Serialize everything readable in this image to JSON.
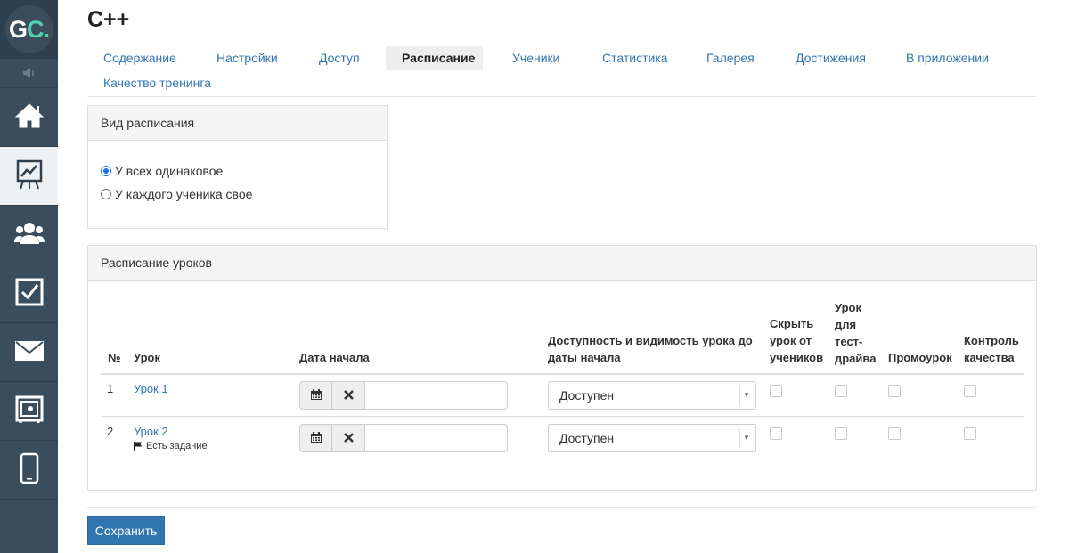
{
  "sidebar": {
    "logo_text": "GC",
    "logo_dot": ".",
    "items": [
      {
        "icon": "home-icon"
      },
      {
        "icon": "chart-board-icon",
        "active": true
      },
      {
        "icon": "users-icon"
      },
      {
        "icon": "checkbox-icon"
      },
      {
        "icon": "mail-icon"
      },
      {
        "icon": "safe-icon"
      },
      {
        "icon": "mobile-icon"
      }
    ]
  },
  "page": {
    "title": "C++"
  },
  "tabs": [
    {
      "label": "Содержание"
    },
    {
      "label": "Настройки"
    },
    {
      "label": "Доступ"
    },
    {
      "label": "Расписание",
      "active": true
    },
    {
      "label": "Ученики"
    },
    {
      "label": "Статистика"
    },
    {
      "label": "Галерея"
    },
    {
      "label": "Достижения"
    },
    {
      "label": "В приложении"
    },
    {
      "label": "Качество тренинга"
    }
  ],
  "schedule_type": {
    "heading": "Вид расписания",
    "options": [
      {
        "label": "У всех одинаковое",
        "checked": true
      },
      {
        "label": "У каждого ученика свое",
        "checked": false
      }
    ]
  },
  "lessons_schedule": {
    "heading": "Расписание уроков",
    "columns": {
      "num": "№",
      "lesson": "Урок",
      "start_date": "Дата начала",
      "availability_l1": "Доступность и видимость урока до",
      "availability_l2": "даты начала",
      "hide_l1": "Скрыть",
      "hide_l2": "урок от",
      "hide_l3": "учеников",
      "trial_l1": "Урок",
      "trial_l2": "для",
      "trial_l3": "тест-",
      "trial_l4": "драйва",
      "promo": "Промоурок",
      "quality_l1": "Контроль",
      "quality_l2": "качества"
    },
    "rows": [
      {
        "num": "1",
        "lesson": "Урок 1",
        "note": "",
        "start_date": "",
        "availability": "Доступен",
        "hide": false,
        "trial": false,
        "promo": false,
        "quality": false
      },
      {
        "num": "2",
        "lesson": "Урок 2",
        "note": "Есть задание",
        "start_date": "",
        "availability": "Доступен",
        "hide": false,
        "trial": false,
        "promo": false,
        "quality": false
      }
    ]
  },
  "actions": {
    "save_label": "Сохранить"
  }
}
